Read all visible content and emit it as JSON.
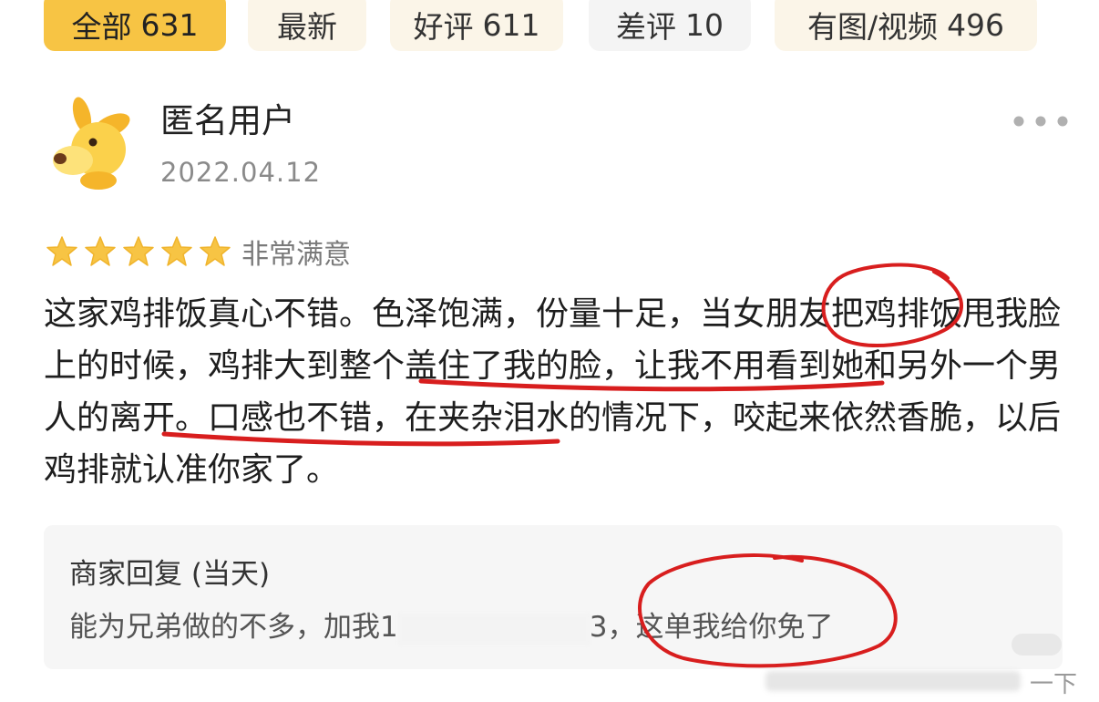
{
  "tabs": [
    {
      "label": "全部",
      "count": "631",
      "active": true
    },
    {
      "label": "最新",
      "count": "",
      "active": false
    },
    {
      "label": "好评",
      "count": "611",
      "active": false
    },
    {
      "label": "差评",
      "count": "10",
      "active": false
    },
    {
      "label": "有图/视频",
      "count": "496",
      "active": false
    }
  ],
  "review": {
    "user": "匿名用户",
    "date": "2022.04.12",
    "rating_value": 5,
    "rating_max": 5,
    "rating_text": "非常满意",
    "segments": [
      "这家鸡排饭真心不错。色泽饱满，份量十足，当",
      "女朋友",
      "把鸡排饭甩我脸上的时候，",
      "鸡排大到整个盖住了我的脸",
      "，让我不用看到",
      "她和另外一个男人的离开",
      "。口感也不错，在夹杂泪水的情况下，咬起来依然香脆，以后鸡排就认准你家了。"
    ]
  },
  "reply": {
    "title": "商家回复 (当天)",
    "text_before": "能为兄弟做的不多，加我1",
    "text_after": "3，这单我给你免了"
  },
  "watermark": {
    "text": "一下"
  },
  "colors": {
    "accent": "#f7c444",
    "star": "#f7c444",
    "annotation": "#d81e1e"
  }
}
